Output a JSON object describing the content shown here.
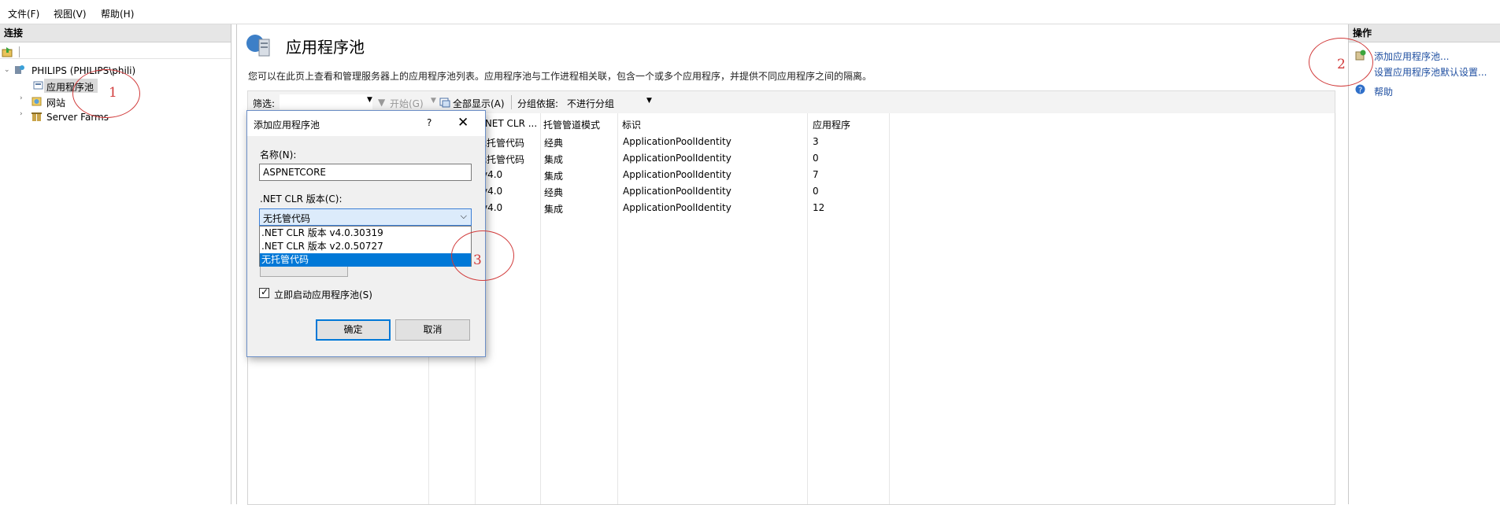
{
  "menu": [
    "文件(F)",
    "视图(V)",
    "帮助(H)"
  ],
  "left": {
    "header": "连接",
    "tree": [
      {
        "label": "PHILIPS (PHILIPS\\phili)"
      },
      {
        "label": "应用程序池"
      },
      {
        "label": "网站"
      },
      {
        "label": "Server Farms"
      }
    ]
  },
  "center": {
    "title": "应用程序池",
    "description": "您可以在此页上查看和管理服务器上的应用程序池列表。应用程序池与工作进程相关联，包含一个或多个应用程序，并提供不同应用程序之间的隔离。",
    "toolbar": {
      "filter_label": "筛选:",
      "start_label": "开始(G)",
      "show_all_label": "全部显示(A)",
      "group_label": "分组依据:",
      "group_value": "不进行分组"
    },
    "columns": [
      ".NET CLR ...",
      "托管管道模式",
      "标识",
      "应用程序"
    ],
    "rows": [
      {
        "clr": "无托管代码",
        "pipeline": "经典",
        "identity": "ApplicationPoolIdentity",
        "apps": "3"
      },
      {
        "clr": "无托管代码",
        "pipeline": "集成",
        "identity": "ApplicationPoolIdentity",
        "apps": "0"
      },
      {
        "clr": "v4.0",
        "pipeline": "集成",
        "identity": "ApplicationPoolIdentity",
        "apps": "7"
      },
      {
        "clr": "v4.0",
        "pipeline": "经典",
        "identity": "ApplicationPoolIdentity",
        "apps": "0"
      },
      {
        "clr": "v4.0",
        "pipeline": "集成",
        "identity": "ApplicationPoolIdentity",
        "apps": "12"
      }
    ]
  },
  "right": {
    "header": "操作",
    "actions": [
      "添加应用程序池...",
      "设置应用程序池默认设置...",
      "帮助"
    ]
  },
  "dialog": {
    "title": "添加应用程序池",
    "help": "?",
    "name_label": "名称(N):",
    "name_value": "ASPNETCORE",
    "clr_label": ".NET CLR 版本(C):",
    "clr_selected": "无托管代码",
    "clr_options": [
      ".NET CLR 版本 v4.0.30319",
      ".NET CLR 版本 v2.0.50727",
      "无托管代码"
    ],
    "autostart_label": "立即启动应用程序池(S)",
    "autostart_checked": true,
    "ok_label": "确定",
    "cancel_label": "取消"
  },
  "annotations": [
    "1",
    "2",
    "3"
  ],
  "colors": {
    "annotation": "#d13b3b",
    "link": "#1e4ea0",
    "selection": "#0078d7"
  }
}
